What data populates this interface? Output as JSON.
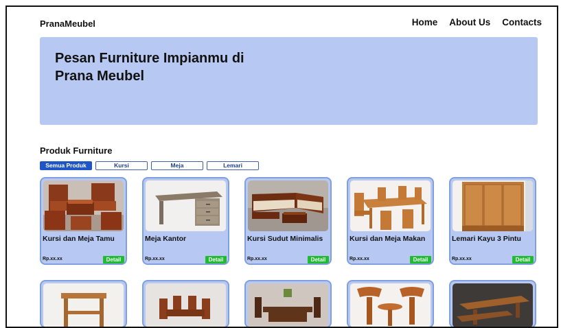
{
  "nav": {
    "brand": "PranaMeubel",
    "links": [
      "Home",
      "About Us",
      "Contacts"
    ]
  },
  "hero": {
    "title_line1": "Pesan Furniture Impianmu di",
    "title_line2": "Prana Meubel"
  },
  "section": {
    "title": "Produk Furniture",
    "filters": [
      "Semua Produk",
      "Kursi",
      "Meja",
      "Lemari"
    ],
    "active_filter": "Semua Produk"
  },
  "products": [
    {
      "name": "Kursi dan Meja Tamu",
      "price": "Rp.xx.xx",
      "detail": "Detail",
      "icon": "living-room-set-icon"
    },
    {
      "name": "Meja Kantor",
      "price": "Rp.xx.xx",
      "detail": "Detail",
      "icon": "office-desk-icon"
    },
    {
      "name": "Kursi Sudut Minimalis",
      "price": "Rp.xx.xx",
      "detail": "Detail",
      "icon": "corner-sofa-icon"
    },
    {
      "name": "Kursi dan Meja Makan",
      "price": "Rp.xx.xx",
      "detail": "Detail",
      "icon": "dining-set-icon"
    },
    {
      "name": "Lemari Kayu 3 Pintu",
      "price": "Rp.xx.xx",
      "detail": "Detail",
      "icon": "wardrobe-icon"
    }
  ],
  "colors": {
    "hero_bg": "#b7c9f3",
    "card_bg": "#b7c9f3",
    "active_filter": "#1f55c4",
    "detail_button": "#1fbb31"
  }
}
